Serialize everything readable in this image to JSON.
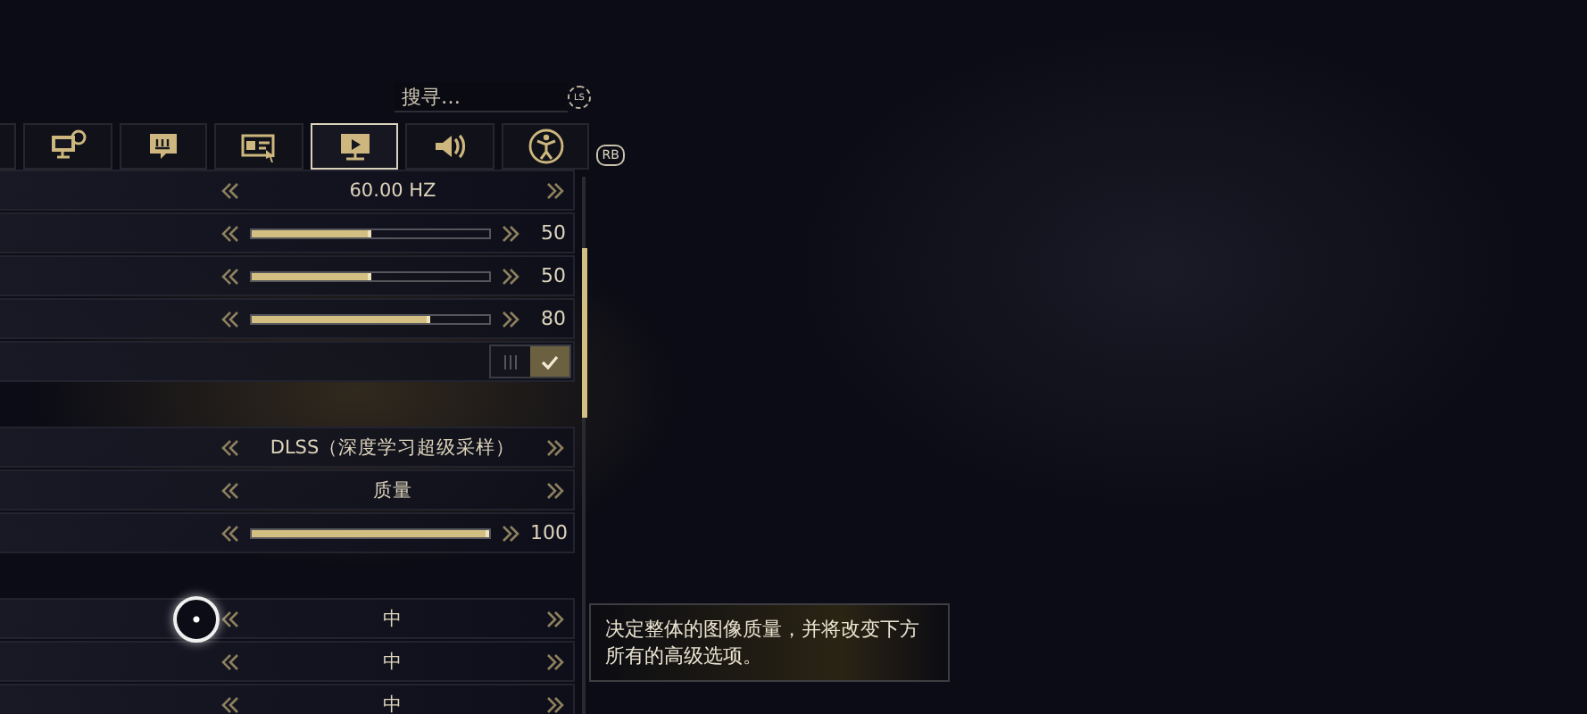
{
  "search": {
    "placeholder": "搜寻…",
    "badge": "LS"
  },
  "tabs": [
    {
      "selected": false
    },
    {
      "selected": false
    },
    {
      "selected": false
    },
    {
      "selected": false
    },
    {
      "selected": true
    },
    {
      "selected": false
    },
    {
      "selected": false
    }
  ],
  "tab_badge": "RB",
  "rows": [
    {
      "kind": "select",
      "value": "60.00 HZ"
    },
    {
      "kind": "slider",
      "level": 0.5,
      "reading": "50"
    },
    {
      "kind": "slider",
      "level": 0.5,
      "reading": "50"
    },
    {
      "kind": "slider",
      "level": 0.75,
      "reading": "80"
    },
    {
      "kind": "toggle",
      "on": true
    },
    {
      "kind": "gap"
    },
    {
      "kind": "select",
      "value": "DLSS（深度学习超级采样）"
    },
    {
      "kind": "select",
      "value": "质量"
    },
    {
      "kind": "slider",
      "level": 1,
      "reading": "100"
    },
    {
      "kind": "gap"
    },
    {
      "kind": "select",
      "value": "中"
    },
    {
      "kind": "select",
      "value": "中"
    },
    {
      "kind": "select",
      "value": "中"
    }
  ],
  "tooltip": {
    "text": "决定整体的图像质量，并将改变下方所有的高级选项。"
  }
}
